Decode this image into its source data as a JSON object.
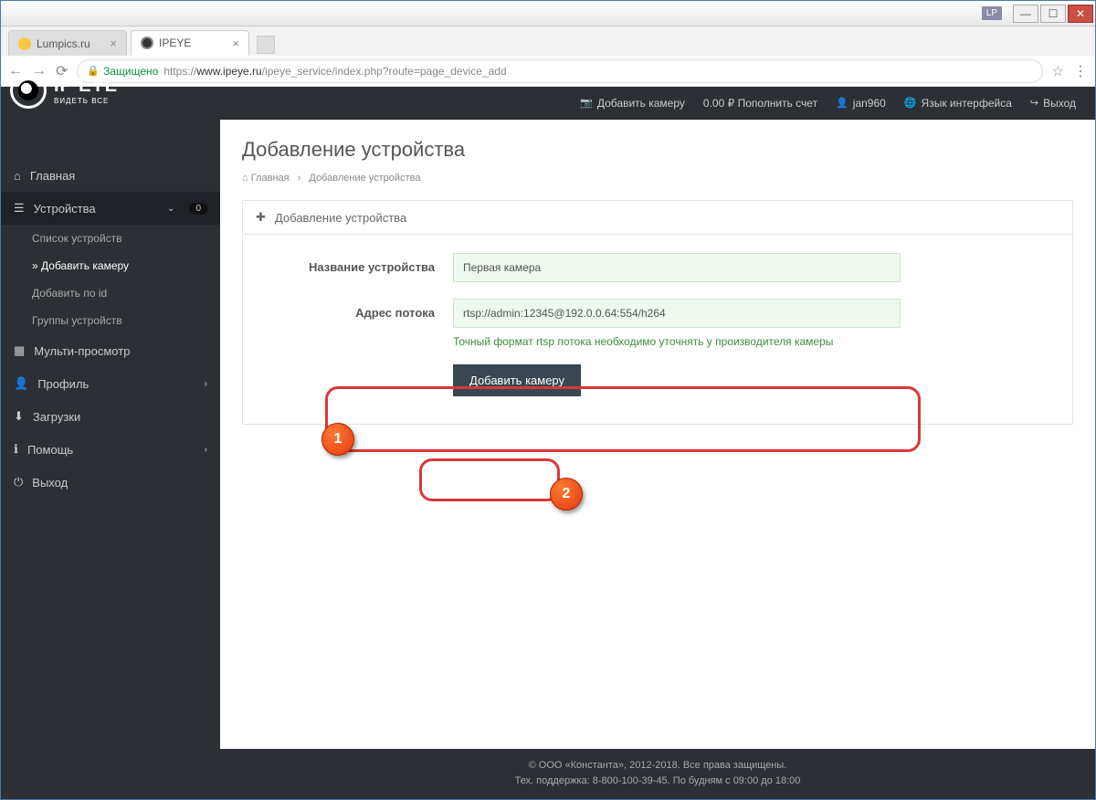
{
  "window": {
    "lp": "LP"
  },
  "tabs": [
    {
      "title": "Lumpics.ru"
    },
    {
      "title": "IPEYE"
    }
  ],
  "addressbar": {
    "secure": "Защищено",
    "proto": "https://",
    "host": "www.ipeye.ru",
    "path": "/ipeye_service/index.php?route=page_device_add"
  },
  "logo": {
    "main": "IP EYE",
    "sub": "ВИДЕТЬ ВСЕ"
  },
  "topnav": {
    "add_camera": "Добавить камеру",
    "balance": "0.00 ₽ Пополнить счет",
    "user": "jan960",
    "language": "Язык интерфейса",
    "logout": "Выход"
  },
  "sidebar": {
    "home": "Главная",
    "devices": "Устройства",
    "devices_badge": "0",
    "device_list": "Список устройств",
    "add_camera": "Добавить камеру",
    "add_by_id": "Добавить по id",
    "device_groups": "Группы устройств",
    "multiview": "Мульти-просмотр",
    "profile": "Профиль",
    "downloads": "Загрузки",
    "help": "Помощь",
    "logout": "Выход"
  },
  "page": {
    "title": "Добавление устройства",
    "bc_home": "Главная",
    "bc_current": "Добавление устройства",
    "panel_title": "Добавление устройства",
    "label_name": "Название устройства",
    "value_name": "Первая камера",
    "label_stream": "Адрес потока",
    "value_stream": "rtsp://admin:12345@192.0.0.64:554/h264",
    "hint_stream": "Точный формат rtsp потока необходимо уточнять у производителя камеры",
    "btn_add": "Добавить камеру"
  },
  "markers": {
    "m1": "1",
    "m2": "2"
  },
  "footer": {
    "line1": "© ООО «Константа», 2012-2018. Все права защищены.",
    "line2": "Тех. поддержка: 8-800-100-39-45. По будням с 09:00 до 18:00"
  }
}
